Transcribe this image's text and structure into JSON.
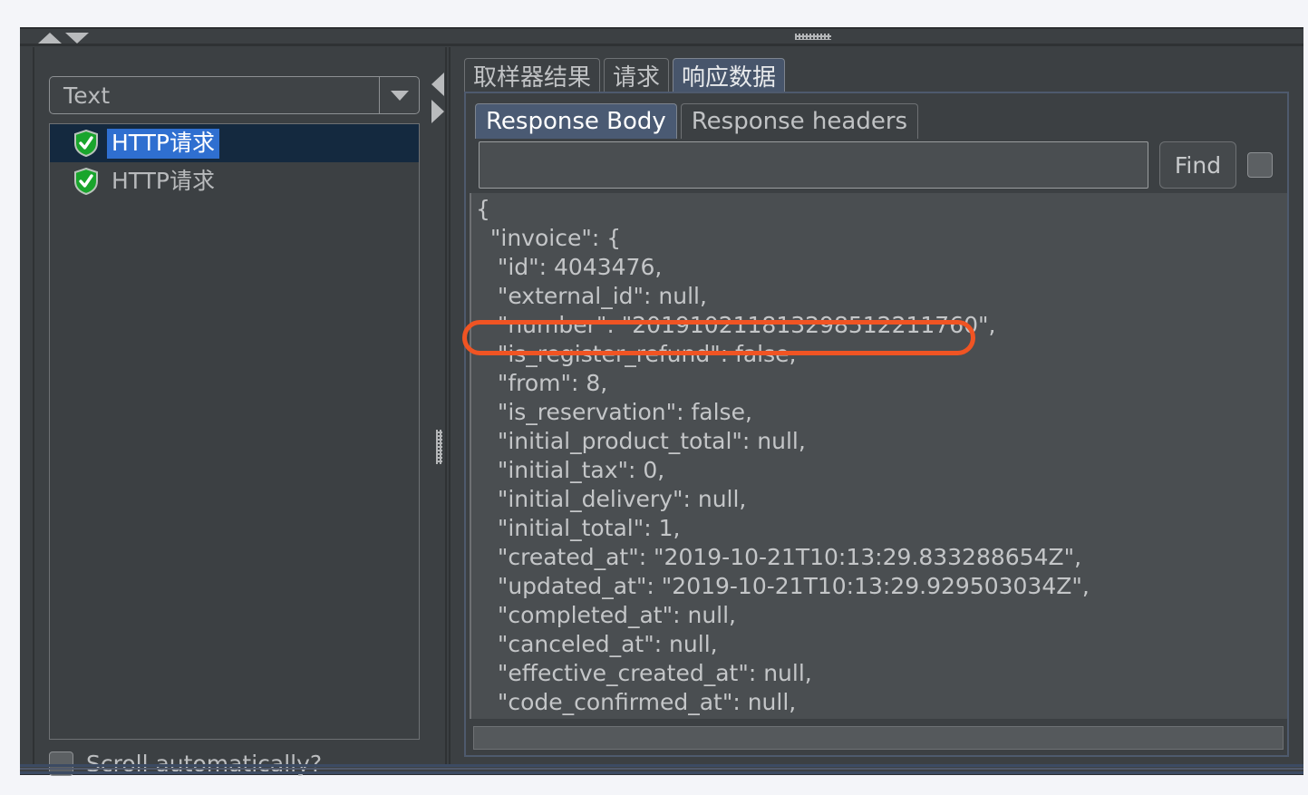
{
  "toolbar": {
    "collapse_up_icon": "triangle-up-icon",
    "collapse_down_icon": "triangle-down-icon",
    "drag_handle_icon": "drag-handle-icon"
  },
  "left_panel": {
    "combo": {
      "selected": "Text",
      "arrow_icon": "chevron-down-icon"
    },
    "tree_items": [
      {
        "label": "HTTP请求",
        "icon": "shield-check-icon",
        "selected": true
      },
      {
        "label": "HTTP请求",
        "icon": "shield-check-icon",
        "selected": false
      }
    ],
    "scroll_automatically": {
      "label": "Scroll automatically?",
      "checked": false
    }
  },
  "splitter": {
    "collapse_left_icon": "triangle-left-icon",
    "collapse_right_icon": "triangle-right-icon",
    "drag_handle_icon": "drag-handle-vertical-icon"
  },
  "right_panel": {
    "outer_tabs": [
      {
        "label": "取样器结果",
        "active": false
      },
      {
        "label": "请求",
        "active": false
      },
      {
        "label": "响应数据",
        "active": true
      }
    ],
    "inner_tabs": [
      {
        "label": "Response Body",
        "active": true
      },
      {
        "label": "Response headers",
        "active": false
      }
    ],
    "find_bar": {
      "input_value": "",
      "input_placeholder": "",
      "find_label": "Find",
      "case_checkbox_checked": false
    },
    "response_body": [
      "{",
      "  \"invoice\": {",
      "   \"id\": 4043476,",
      "   \"external_id\": null,",
      "   \"number\": \"201910211813298512211760\",",
      "   \"is_register_refund\": false,",
      "   \"from\": 8,",
      "   \"is_reservation\": false,",
      "   \"initial_product_total\": null,",
      "   \"initial_tax\": 0,",
      "   \"initial_delivery\": null,",
      "   \"initial_total\": 1,",
      "   \"created_at\": \"2019-10-21T10:13:29.833288654Z\",",
      "   \"updated_at\": \"2019-10-21T10:13:29.929503034Z\",",
      "   \"completed_at\": null,",
      "   \"canceled_at\": null,",
      "   \"effective_created_at\": null,",
      "   \"code_confirmed_at\": null,"
    ]
  },
  "annotation": {
    "shape": "rounded-rectangle",
    "color": "#f05423",
    "highlights_line": "\"number\": \"201910211813298512211760\","
  },
  "colors": {
    "window_background": "#3c4043",
    "panel_background": "#4a4e51",
    "selected_tab": "#47556b",
    "tree_selection": "#2f6fd0",
    "tree_selected_row": "#14293f",
    "accent_annotation": "#f05423",
    "text_primary": "#c4c6c8",
    "shield_green": "#1faa32"
  }
}
